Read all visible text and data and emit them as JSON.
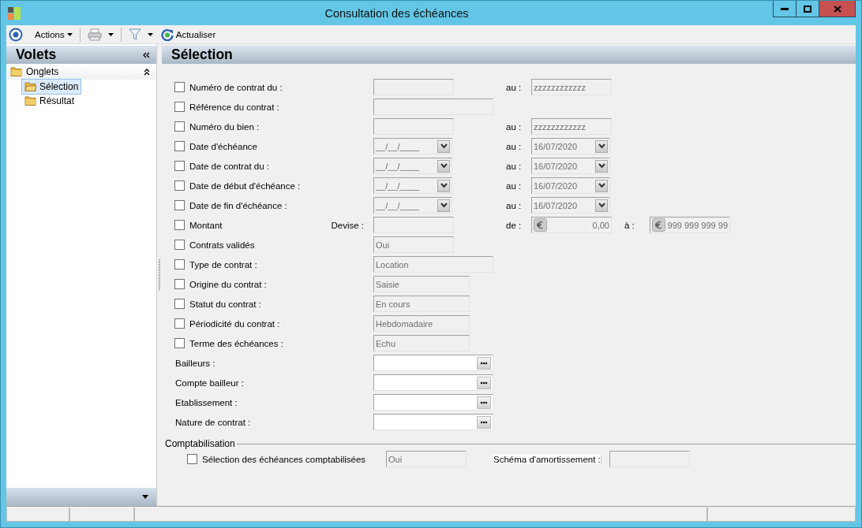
{
  "window": {
    "title": "Consultation des échéances"
  },
  "toolbar": {
    "actions": "Actions",
    "refresh": "Actualiser"
  },
  "sidebar": {
    "title": "Volets",
    "group": "Onglets",
    "expanded": true,
    "items": [
      {
        "label": "Sélection",
        "selected": true
      },
      {
        "label": "Résultat",
        "selected": false
      }
    ]
  },
  "main": {
    "title": "Sélection",
    "rows": [
      {
        "kind": "check",
        "label": "Numéro de contrat du :",
        "checked": false,
        "fields": [
          {
            "kind": "text"
          },
          {
            "kind": "text",
            "label": "au :",
            "value": "zzzzzzzzzzzz"
          }
        ]
      },
      {
        "kind": "check",
        "label": "Référence du contrat :",
        "checked": false,
        "fields": [
          {
            "kind": "wide"
          }
        ]
      },
      {
        "kind": "check",
        "label": "Numéro du bien :",
        "checked": false,
        "fields": [
          {
            "kind": "text"
          },
          {
            "kind": "text",
            "label": "au :",
            "value": "zzzzzzzzzzzz"
          }
        ]
      },
      {
        "kind": "check",
        "label": "Date d'échéance",
        "checked": false,
        "fields": [
          {
            "kind": "date",
            "value": "__/__/____"
          },
          {
            "kind": "date",
            "label": "au :",
            "value": "16/07/2020"
          }
        ]
      },
      {
        "kind": "check",
        "label": "Date de contrat du :",
        "checked": false,
        "fields": [
          {
            "kind": "date",
            "value": "__/__/____"
          },
          {
            "kind": "date",
            "label": "au :",
            "value": "16/07/2020"
          }
        ]
      },
      {
        "kind": "check",
        "label": "Date de début d'échéance :",
        "checked": false,
        "fields": [
          {
            "kind": "date",
            "value": "__/__/____"
          },
          {
            "kind": "date",
            "label": "au :",
            "value": "16/07/2020"
          }
        ]
      },
      {
        "kind": "check",
        "label": "Date de fin d'échéance :",
        "checked": false,
        "fields": [
          {
            "kind": "date",
            "value": "__/__/____"
          },
          {
            "kind": "date",
            "label": "au :",
            "value": "16/07/2020"
          }
        ]
      },
      {
        "kind": "check",
        "label": "Montant",
        "checked": false,
        "fields": [
          {
            "kind": "text",
            "label": "Devise :"
          },
          {
            "kind": "money",
            "label": "de :",
            "value": "0,00"
          },
          {
            "kind": "money",
            "label": "à :",
            "value": "999 999 999 99"
          }
        ]
      },
      {
        "kind": "check",
        "label": "Contrats validés",
        "checked": false,
        "fields": [
          {
            "kind": "text",
            "value": "Oui"
          }
        ]
      },
      {
        "kind": "check",
        "label": "Type de contrat :",
        "checked": false,
        "fields": [
          {
            "kind": "medium",
            "value": "Location"
          }
        ]
      },
      {
        "kind": "check",
        "label": "Origine du contrat :",
        "checked": false,
        "fields": [
          {
            "kind": "value",
            "value": "Saisie"
          }
        ]
      },
      {
        "kind": "check",
        "label": "Statut du contrat :",
        "checked": false,
        "fields": [
          {
            "kind": "value",
            "value": "En cours"
          }
        ]
      },
      {
        "kind": "check",
        "label": "Périodicité du contrat :",
        "checked": false,
        "fields": [
          {
            "kind": "value",
            "value": "Hebdomadaire"
          }
        ]
      },
      {
        "kind": "check",
        "label": "Terme des échéances :",
        "checked": false,
        "fields": [
          {
            "kind": "value",
            "value": "Echu"
          }
        ]
      },
      {
        "kind": "plain",
        "label": "Bailleurs :",
        "fields": [
          {
            "kind": "lookup"
          }
        ]
      },
      {
        "kind": "plain",
        "label": "Compte bailleur :",
        "fields": [
          {
            "kind": "lookup"
          }
        ]
      },
      {
        "kind": "plain",
        "label": "Etablissement :",
        "fields": [
          {
            "kind": "lookup"
          }
        ]
      },
      {
        "kind": "plain",
        "label": "Nature de contrat :",
        "fields": [
          {
            "kind": "lookup"
          }
        ]
      }
    ],
    "section": {
      "title": "Comptabilisation",
      "rows": [
        {
          "kind": "check",
          "label": "Sélection des échéances comptabilisées",
          "checked": false,
          "fields": [
            {
              "kind": "text",
              "value": "Oui"
            },
            {
              "kind": "side",
              "label": "Schéma d'amortissement :"
            }
          ]
        }
      ]
    }
  }
}
